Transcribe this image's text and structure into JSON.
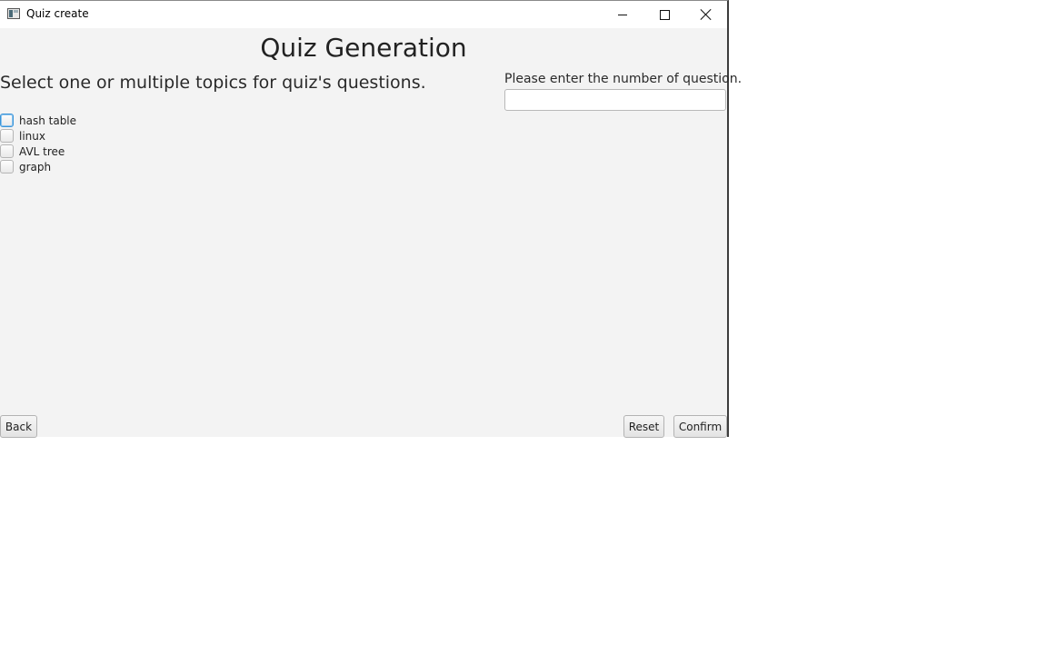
{
  "window": {
    "title": "Quiz create",
    "icon": "app-icon"
  },
  "main": {
    "heading": "Quiz Generation",
    "subtitle": "Select one or multiple topics for quiz's questions.",
    "number_label": "Please enter the number of question.",
    "number_value": "",
    "number_placeholder": ""
  },
  "topics": [
    {
      "label": "hash table",
      "checked": false,
      "focused": true
    },
    {
      "label": "linux",
      "checked": false,
      "focused": false
    },
    {
      "label": "AVL tree",
      "checked": false,
      "focused": false
    },
    {
      "label": "graph",
      "checked": false,
      "focused": false
    }
  ],
  "buttons": {
    "back": "Back",
    "reset": "Reset",
    "confirm": "Confirm"
  },
  "colors": {
    "background": "#f3f3f3",
    "focus_accent": "#3a94d8"
  }
}
